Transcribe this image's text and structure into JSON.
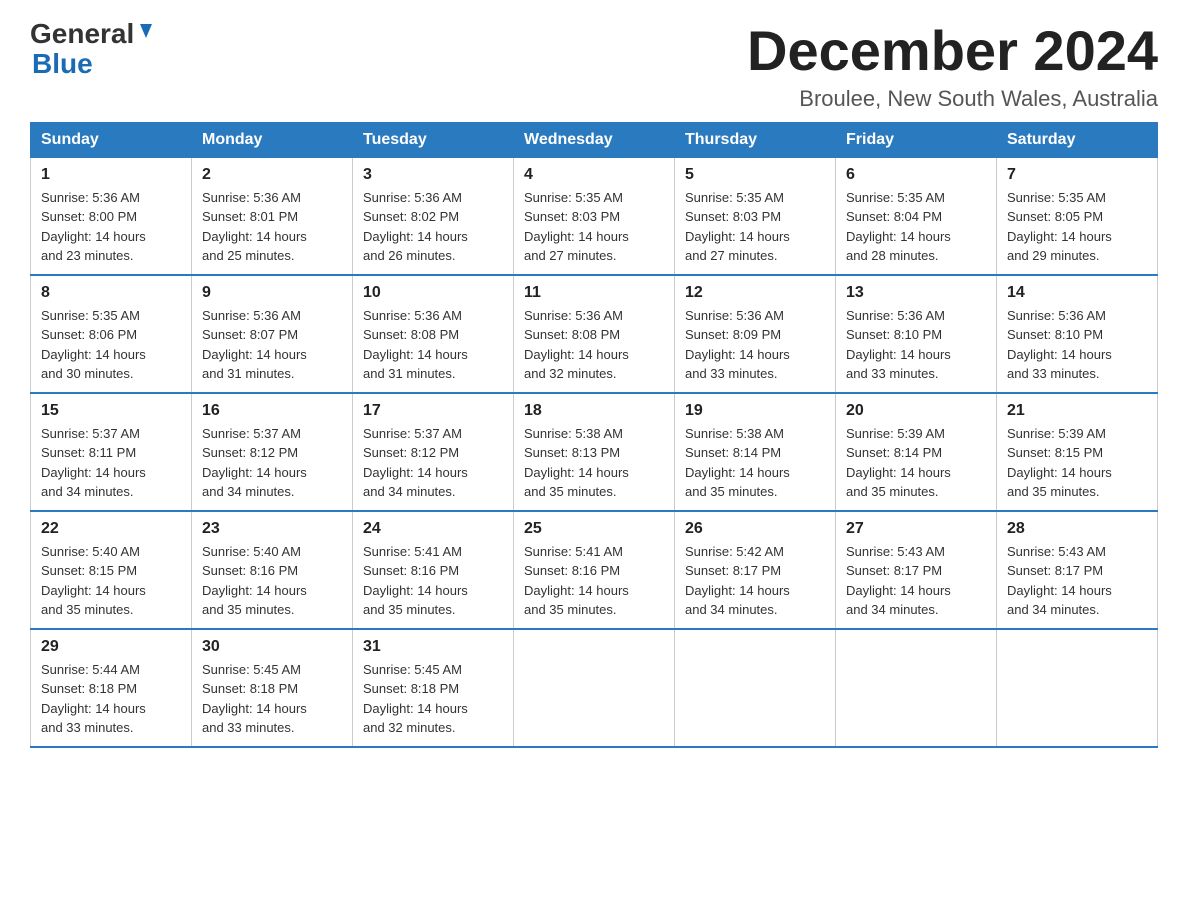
{
  "header": {
    "logo_general": "General",
    "logo_blue": "Blue",
    "month_title": "December 2024",
    "location": "Broulee, New South Wales, Australia"
  },
  "days_of_week": [
    "Sunday",
    "Monday",
    "Tuesday",
    "Wednesday",
    "Thursday",
    "Friday",
    "Saturday"
  ],
  "weeks": [
    [
      {
        "day": "1",
        "sunrise": "5:36 AM",
        "sunset": "8:00 PM",
        "daylight": "14 hours and 23 minutes."
      },
      {
        "day": "2",
        "sunrise": "5:36 AM",
        "sunset": "8:01 PM",
        "daylight": "14 hours and 25 minutes."
      },
      {
        "day": "3",
        "sunrise": "5:36 AM",
        "sunset": "8:02 PM",
        "daylight": "14 hours and 26 minutes."
      },
      {
        "day": "4",
        "sunrise": "5:35 AM",
        "sunset": "8:03 PM",
        "daylight": "14 hours and 27 minutes."
      },
      {
        "day": "5",
        "sunrise": "5:35 AM",
        "sunset": "8:03 PM",
        "daylight": "14 hours and 27 minutes."
      },
      {
        "day": "6",
        "sunrise": "5:35 AM",
        "sunset": "8:04 PM",
        "daylight": "14 hours and 28 minutes."
      },
      {
        "day": "7",
        "sunrise": "5:35 AM",
        "sunset": "8:05 PM",
        "daylight": "14 hours and 29 minutes."
      }
    ],
    [
      {
        "day": "8",
        "sunrise": "5:35 AM",
        "sunset": "8:06 PM",
        "daylight": "14 hours and 30 minutes."
      },
      {
        "day": "9",
        "sunrise": "5:36 AM",
        "sunset": "8:07 PM",
        "daylight": "14 hours and 31 minutes."
      },
      {
        "day": "10",
        "sunrise": "5:36 AM",
        "sunset": "8:08 PM",
        "daylight": "14 hours and 31 minutes."
      },
      {
        "day": "11",
        "sunrise": "5:36 AM",
        "sunset": "8:08 PM",
        "daylight": "14 hours and 32 minutes."
      },
      {
        "day": "12",
        "sunrise": "5:36 AM",
        "sunset": "8:09 PM",
        "daylight": "14 hours and 33 minutes."
      },
      {
        "day": "13",
        "sunrise": "5:36 AM",
        "sunset": "8:10 PM",
        "daylight": "14 hours and 33 minutes."
      },
      {
        "day": "14",
        "sunrise": "5:36 AM",
        "sunset": "8:10 PM",
        "daylight": "14 hours and 33 minutes."
      }
    ],
    [
      {
        "day": "15",
        "sunrise": "5:37 AM",
        "sunset": "8:11 PM",
        "daylight": "14 hours and 34 minutes."
      },
      {
        "day": "16",
        "sunrise": "5:37 AM",
        "sunset": "8:12 PM",
        "daylight": "14 hours and 34 minutes."
      },
      {
        "day": "17",
        "sunrise": "5:37 AM",
        "sunset": "8:12 PM",
        "daylight": "14 hours and 34 minutes."
      },
      {
        "day": "18",
        "sunrise": "5:38 AM",
        "sunset": "8:13 PM",
        "daylight": "14 hours and 35 minutes."
      },
      {
        "day": "19",
        "sunrise": "5:38 AM",
        "sunset": "8:14 PM",
        "daylight": "14 hours and 35 minutes."
      },
      {
        "day": "20",
        "sunrise": "5:39 AM",
        "sunset": "8:14 PM",
        "daylight": "14 hours and 35 minutes."
      },
      {
        "day": "21",
        "sunrise": "5:39 AM",
        "sunset": "8:15 PM",
        "daylight": "14 hours and 35 minutes."
      }
    ],
    [
      {
        "day": "22",
        "sunrise": "5:40 AM",
        "sunset": "8:15 PM",
        "daylight": "14 hours and 35 minutes."
      },
      {
        "day": "23",
        "sunrise": "5:40 AM",
        "sunset": "8:16 PM",
        "daylight": "14 hours and 35 minutes."
      },
      {
        "day": "24",
        "sunrise": "5:41 AM",
        "sunset": "8:16 PM",
        "daylight": "14 hours and 35 minutes."
      },
      {
        "day": "25",
        "sunrise": "5:41 AM",
        "sunset": "8:16 PM",
        "daylight": "14 hours and 35 minutes."
      },
      {
        "day": "26",
        "sunrise": "5:42 AM",
        "sunset": "8:17 PM",
        "daylight": "14 hours and 34 minutes."
      },
      {
        "day": "27",
        "sunrise": "5:43 AM",
        "sunset": "8:17 PM",
        "daylight": "14 hours and 34 minutes."
      },
      {
        "day": "28",
        "sunrise": "5:43 AM",
        "sunset": "8:17 PM",
        "daylight": "14 hours and 34 minutes."
      }
    ],
    [
      {
        "day": "29",
        "sunrise": "5:44 AM",
        "sunset": "8:18 PM",
        "daylight": "14 hours and 33 minutes."
      },
      {
        "day": "30",
        "sunrise": "5:45 AM",
        "sunset": "8:18 PM",
        "daylight": "14 hours and 33 minutes."
      },
      {
        "day": "31",
        "sunrise": "5:45 AM",
        "sunset": "8:18 PM",
        "daylight": "14 hours and 32 minutes."
      },
      null,
      null,
      null,
      null
    ]
  ],
  "labels": {
    "sunrise": "Sunrise:",
    "sunset": "Sunset:",
    "daylight": "Daylight:"
  }
}
